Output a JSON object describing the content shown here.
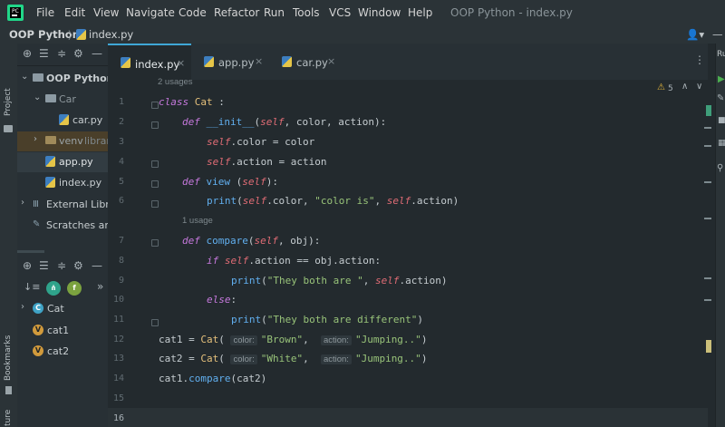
{
  "menu": [
    "File",
    "Edit",
    "View",
    "Navigate",
    "Code",
    "Refactor",
    "Run",
    "Tools",
    "VCS",
    "Window",
    "Help"
  ],
  "window_title": "OOP Python - index.py",
  "breadcrumb": {
    "project": "OOP Python",
    "file": "index.py"
  },
  "left_strip": {
    "project": "Project",
    "bookmarks": "Bookmarks",
    "structure": "ture"
  },
  "project_tree": {
    "root": "OOP Python",
    "car_folder": "Car",
    "car_file": "car.py",
    "venv": "venv",
    "venv_suffix": "library",
    "app": "app.py",
    "index": "index.py",
    "external": "External Librar",
    "scratches": "Scratches and"
  },
  "structure": {
    "cls": "Cat",
    "cat1": "cat1",
    "cat2": "cat2",
    "badge_c": "C",
    "badge_v": "V",
    "more": "»"
  },
  "tabs": [
    "index.py",
    "app.py",
    "car.py"
  ],
  "editor": {
    "usages1": "2 usages",
    "usages2": "1 usage",
    "warnings": "5",
    "line_numbers": [
      "1",
      "2",
      "3",
      "4",
      "5",
      "6",
      "7",
      "8",
      "9",
      "10",
      "11",
      "12",
      "13",
      "14",
      "15",
      "16"
    ],
    "inlay_color": "color:",
    "inlay_action": "action:"
  },
  "right_strip_label": "Ru"
}
